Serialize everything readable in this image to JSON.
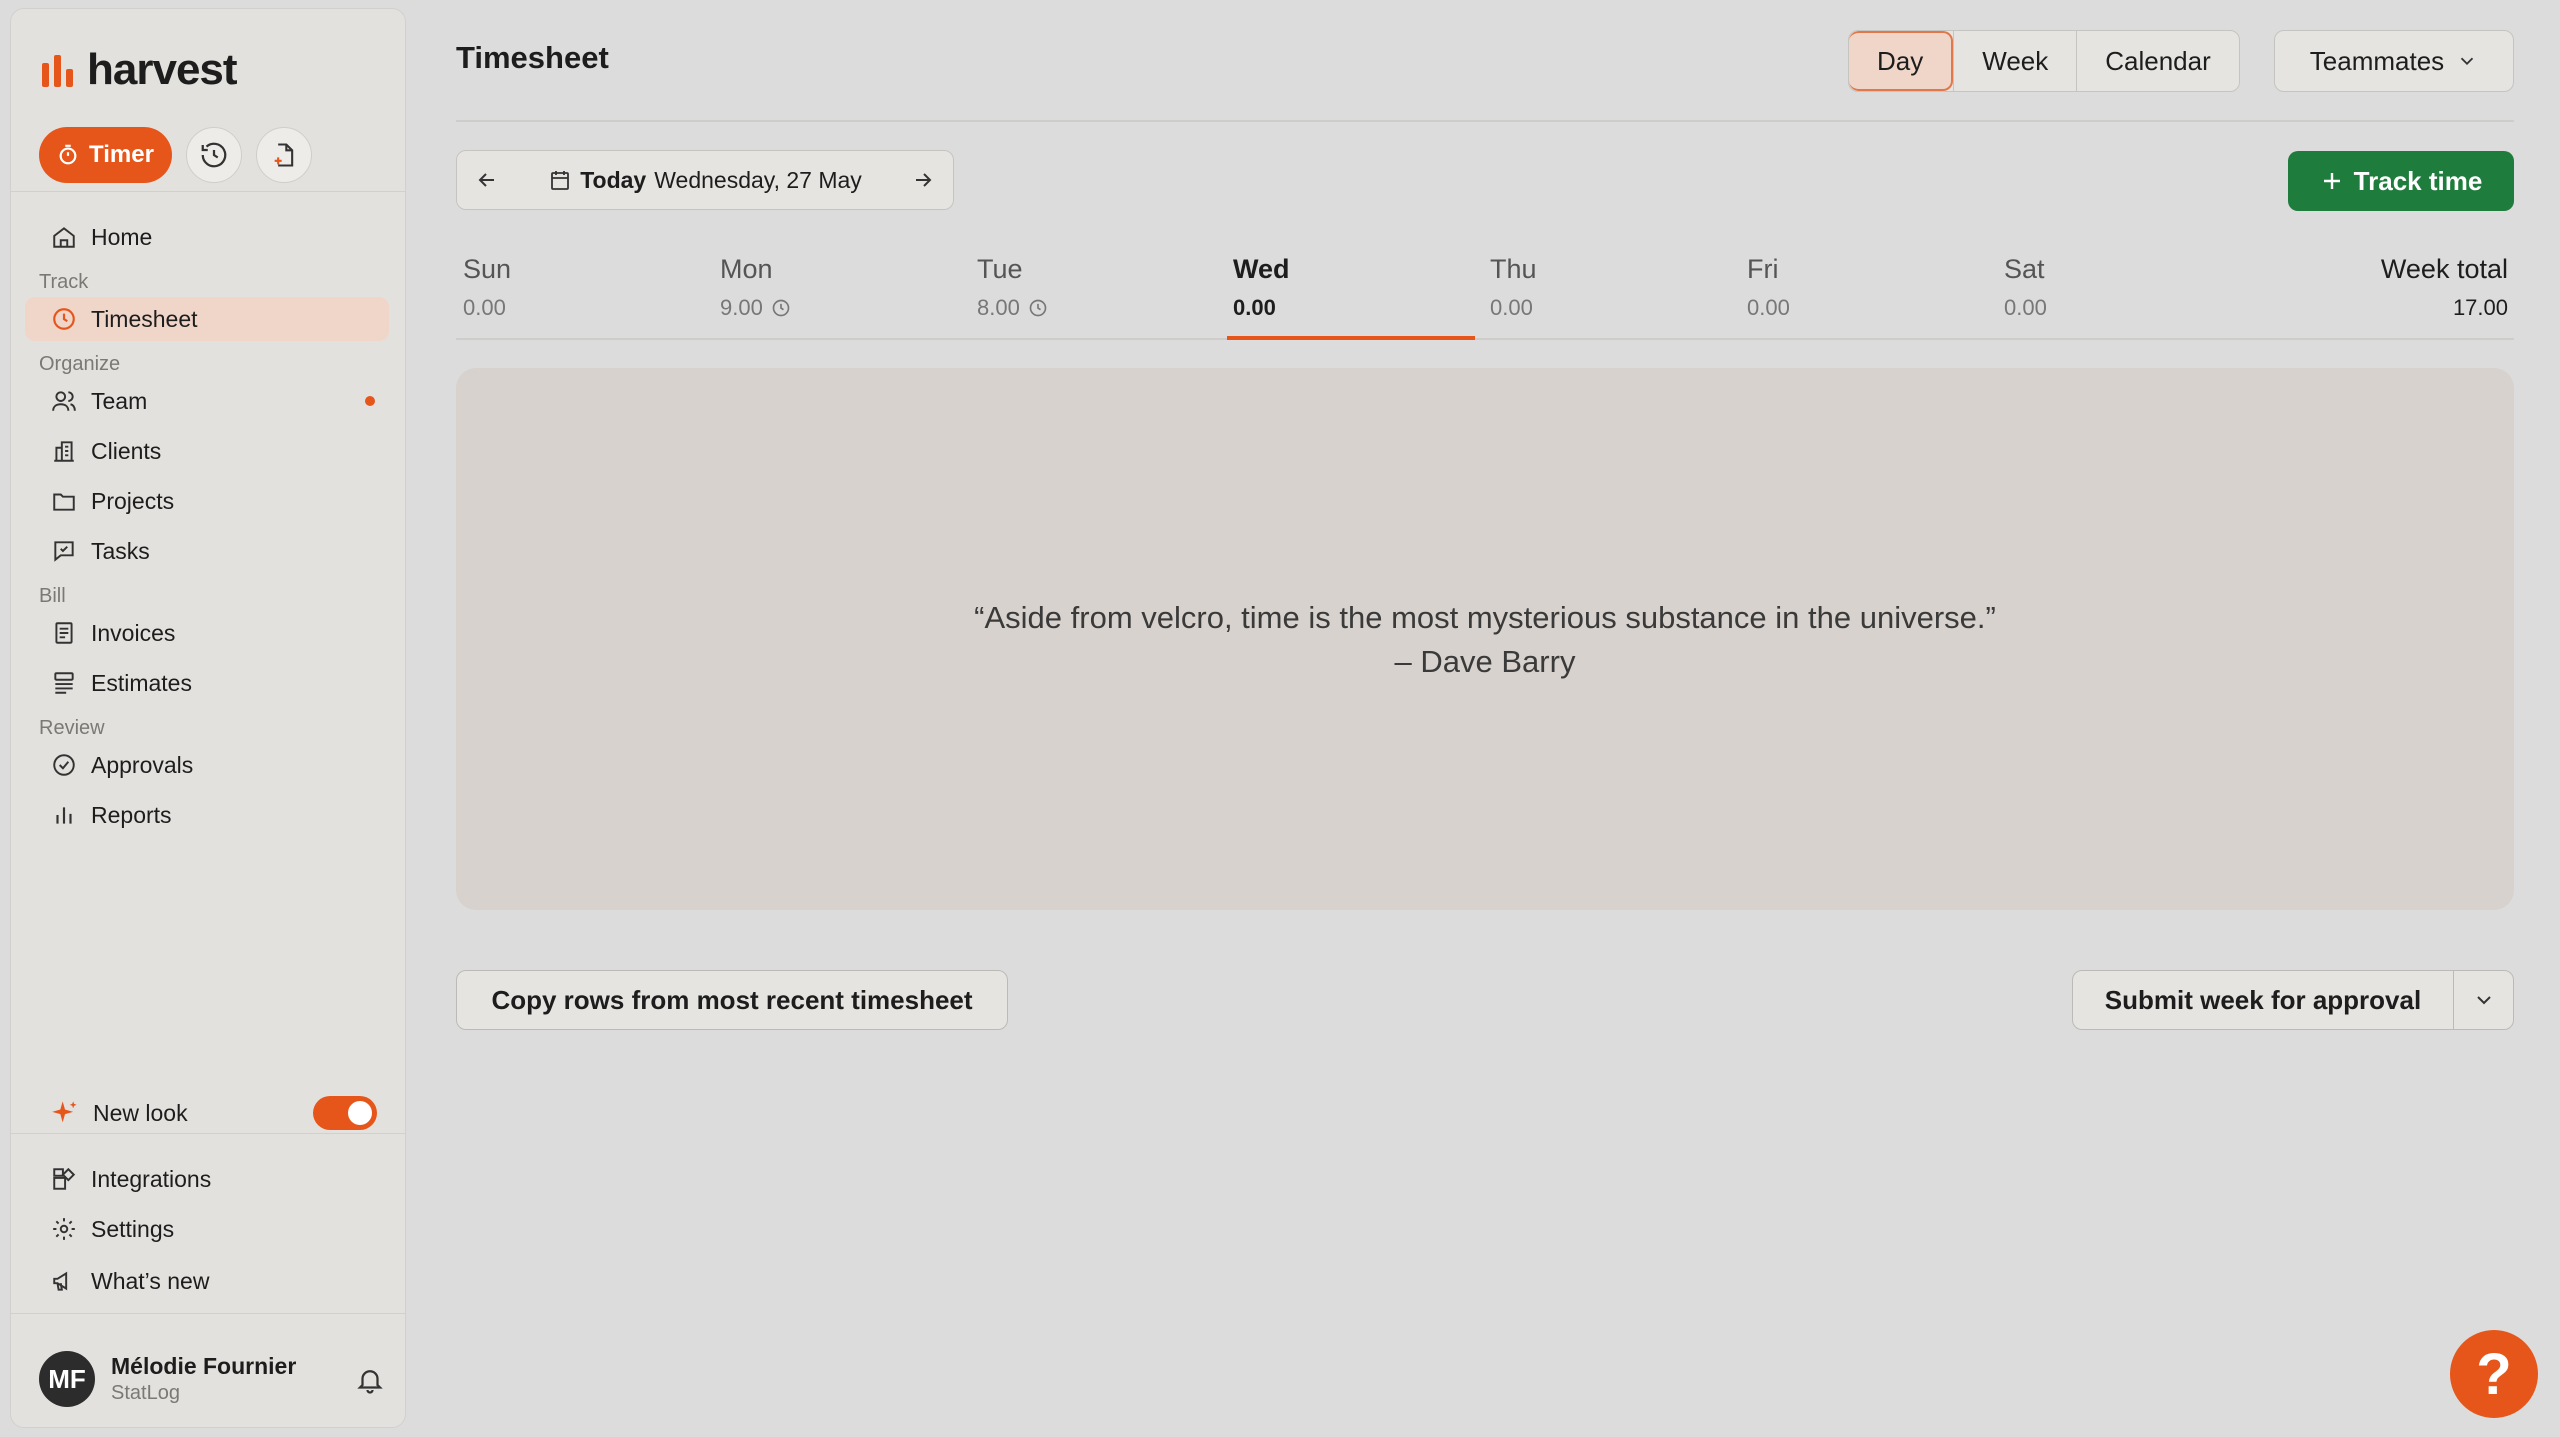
{
  "app": {
    "brand": "harvest",
    "accent": "#e6561a",
    "green": "#1e7c3c"
  },
  "sidebar": {
    "timer_label": "Timer",
    "items": [
      {
        "label": "Home",
        "icon": "home-icon"
      },
      {
        "section": "Track"
      },
      {
        "label": "Timesheet",
        "icon": "clock-icon",
        "active": true
      },
      {
        "section": "Organize"
      },
      {
        "label": "Team",
        "icon": "people-icon",
        "notification": true
      },
      {
        "label": "Clients",
        "icon": "building-icon"
      },
      {
        "label": "Projects",
        "icon": "folder-icon"
      },
      {
        "label": "Tasks",
        "icon": "task-icon"
      },
      {
        "section": "Bill"
      },
      {
        "label": "Invoices",
        "icon": "invoice-icon"
      },
      {
        "label": "Estimates",
        "icon": "estimate-icon"
      },
      {
        "section": "Review"
      },
      {
        "label": "Approvals",
        "icon": "check-circle-icon"
      },
      {
        "label": "Reports",
        "icon": "bar-chart-icon"
      }
    ],
    "sections": {
      "track": "Track",
      "organize": "Organize",
      "bill": "Bill",
      "review": "Review"
    },
    "labels": {
      "home": "Home",
      "timesheet": "Timesheet",
      "team": "Team",
      "clients": "Clients",
      "projects": "Projects",
      "tasks": "Tasks",
      "invoices": "Invoices",
      "estimates": "Estimates",
      "approvals": "Approvals",
      "reports": "Reports"
    },
    "new_look": {
      "label": "New look",
      "enabled": true
    },
    "bottom": {
      "integrations": "Integrations",
      "settings": "Settings",
      "whats_new": "What’s new"
    },
    "user": {
      "initials": "MF",
      "name": "Mélodie Fournier",
      "org": "StatLog"
    }
  },
  "header": {
    "title": "Timesheet",
    "views": [
      "Day",
      "Week",
      "Calendar"
    ],
    "selected_view": "Day",
    "teammates": "Teammates"
  },
  "date_nav": {
    "today": "Today",
    "date": "Wednesday, 27 May"
  },
  "track_time": "Track time",
  "days": [
    {
      "name": "Sun",
      "hours": "0.00"
    },
    {
      "name": "Mon",
      "hours": "9.00",
      "clock": true
    },
    {
      "name": "Tue",
      "hours": "8.00",
      "clock": true
    },
    {
      "name": "Wed",
      "hours": "0.00",
      "current": true
    },
    {
      "name": "Thu",
      "hours": "0.00"
    },
    {
      "name": "Fri",
      "hours": "0.00"
    },
    {
      "name": "Sat",
      "hours": "0.00"
    }
  ],
  "week_total": {
    "label": "Week total",
    "hours": "17.00"
  },
  "empty_state": {
    "quote": "“Aside from velcro, time is the most mysterious substance in the universe.”",
    "author": "– Dave Barry"
  },
  "actions": {
    "copy_rows": "Copy rows from most recent timesheet",
    "submit": "Submit week for approval"
  },
  "help_label": "?"
}
